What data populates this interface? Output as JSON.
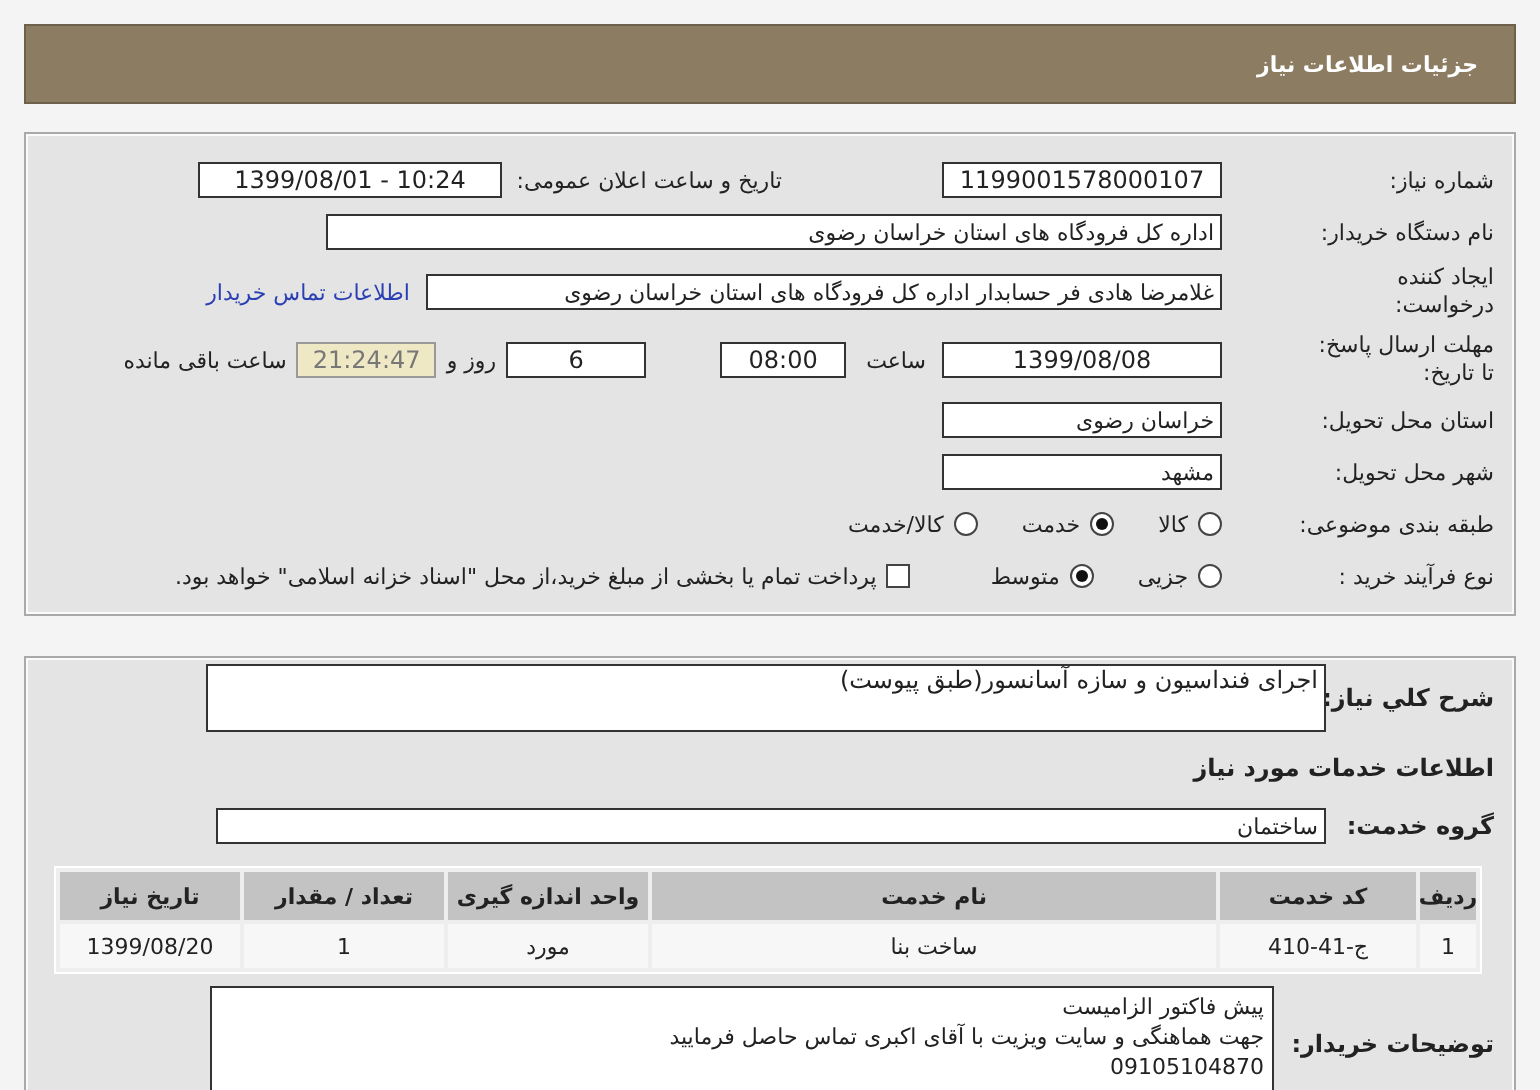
{
  "header": {
    "title": "جزئیات اطلاعات نیاز"
  },
  "need_number": {
    "label": "شماره نیاز:",
    "value": "1199001578000107"
  },
  "announce": {
    "label": "تاریخ و ساعت اعلان عمومی:",
    "value": "1399/08/01 - 10:24"
  },
  "buyer_org": {
    "label": "نام دستگاه خریدار:",
    "value": "اداره کل فرودگاه های استان خراسان رضوی"
  },
  "requester": {
    "label_lines": [
      "ایجاد کننده",
      "درخواست:"
    ],
    "value": "غلامرضا هادی فر حسابدار اداره کل فرودگاه های استان خراسان رضوی",
    "link": "اطلاعات تماس خریدار"
  },
  "deadline": {
    "label_lines": [
      "مهلت ارسال پاسخ:",
      "تا تاریخ:"
    ],
    "date": "1399/08/08",
    "time_label": "ساعت",
    "time": "08:00",
    "days": "6",
    "days_label": "روز و",
    "remaining": "21:24:47",
    "remaining_label": "ساعت باقی مانده"
  },
  "province": {
    "label": "استان محل تحویل:",
    "value": "خراسان رضوی"
  },
  "city": {
    "label": "شهر محل تحویل:",
    "value": "مشهد"
  },
  "category": {
    "label": "طبقه بندی موضوعی:",
    "options": [
      {
        "label": "کالا",
        "selected": false
      },
      {
        "label": "خدمت",
        "selected": true
      },
      {
        "label": "کالا/خدمت",
        "selected": false
      }
    ]
  },
  "process": {
    "label": "نوع فرآیند خرید :",
    "options": [
      {
        "label": "جزیی",
        "selected": false
      },
      {
        "label": "متوسط",
        "selected": true
      }
    ],
    "treasury": {
      "checked": false,
      "label": "پرداخت تمام یا بخشی از مبلغ خرید،از محل \"اسناد خزانه اسلامی\" خواهد بود."
    }
  },
  "description": {
    "label": "شرح کلي نياز:",
    "value": "اجرای فنداسیون و سازه آسانسور(طبق پیوست)"
  },
  "services_heading": "اطلاعات خدمات مورد نیاز",
  "service_group": {
    "label": "گروه خدمت:",
    "value": "ساختمان"
  },
  "table": {
    "columns": [
      "ردیف",
      "کد خدمت",
      "نام خدمت",
      "واحد اندازه گیری",
      "تعداد / مقدار",
      "تاریخ نیاز"
    ],
    "rows": [
      [
        "1",
        "ج-41-410",
        "ساخت بنا",
        "مورد",
        "1",
        "1399/08/20"
      ]
    ]
  },
  "buyer_notes": {
    "label": "توضیحات خریدار:",
    "lines": [
      "پیش فاکتور الزامیست",
      "جهت هماهنگی و سایت ویزیت با آقای اکبری تماس حاصل فرمایید",
      "09105104870"
    ]
  }
}
